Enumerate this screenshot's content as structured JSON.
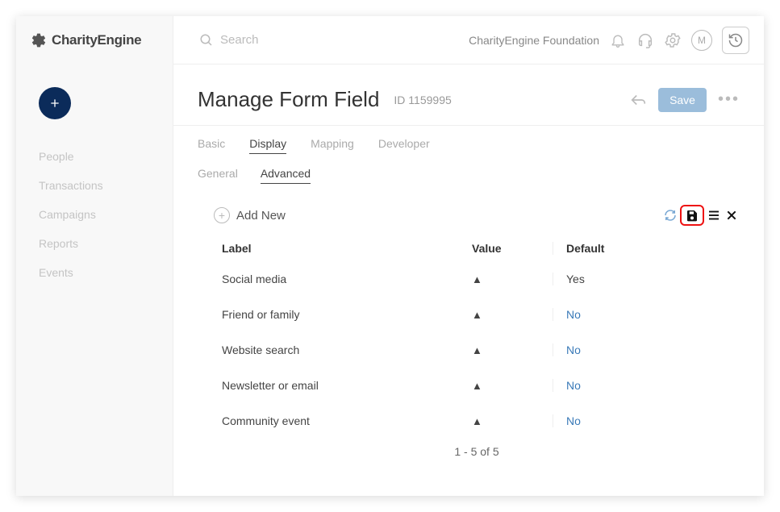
{
  "brand": {
    "name": "CharityEngine"
  },
  "sidebar": {
    "items": [
      {
        "label": "People"
      },
      {
        "label": "Transactions"
      },
      {
        "label": "Campaigns"
      },
      {
        "label": "Reports"
      },
      {
        "label": "Events"
      }
    ]
  },
  "topbar": {
    "search_placeholder": "Search",
    "org": "CharityEngine Foundation",
    "avatar_initial": "M"
  },
  "header": {
    "title": "Manage Form Field",
    "id_label": "ID 1159995",
    "save_label": "Save"
  },
  "tabs1": [
    {
      "label": "Basic",
      "active": false
    },
    {
      "label": "Display",
      "active": true
    },
    {
      "label": "Mapping",
      "active": false
    },
    {
      "label": "Developer",
      "active": false
    }
  ],
  "tabs2": [
    {
      "label": "General",
      "active": false
    },
    {
      "label": "Advanced",
      "active": true
    }
  ],
  "content": {
    "add_new_label": "Add New",
    "columns": {
      "label": "Label",
      "value": "Value",
      "default": "Default"
    },
    "rows": [
      {
        "label": "Social media",
        "default": "Yes",
        "default_yes": true
      },
      {
        "label": "Friend or family",
        "default": "No",
        "default_yes": false
      },
      {
        "label": "Website search",
        "default": "No",
        "default_yes": false
      },
      {
        "label": "Newsletter or email",
        "default": "No",
        "default_yes": false
      },
      {
        "label": "Community event",
        "default": "No",
        "default_yes": false
      }
    ],
    "pagination": "1 - 5 of 5"
  }
}
